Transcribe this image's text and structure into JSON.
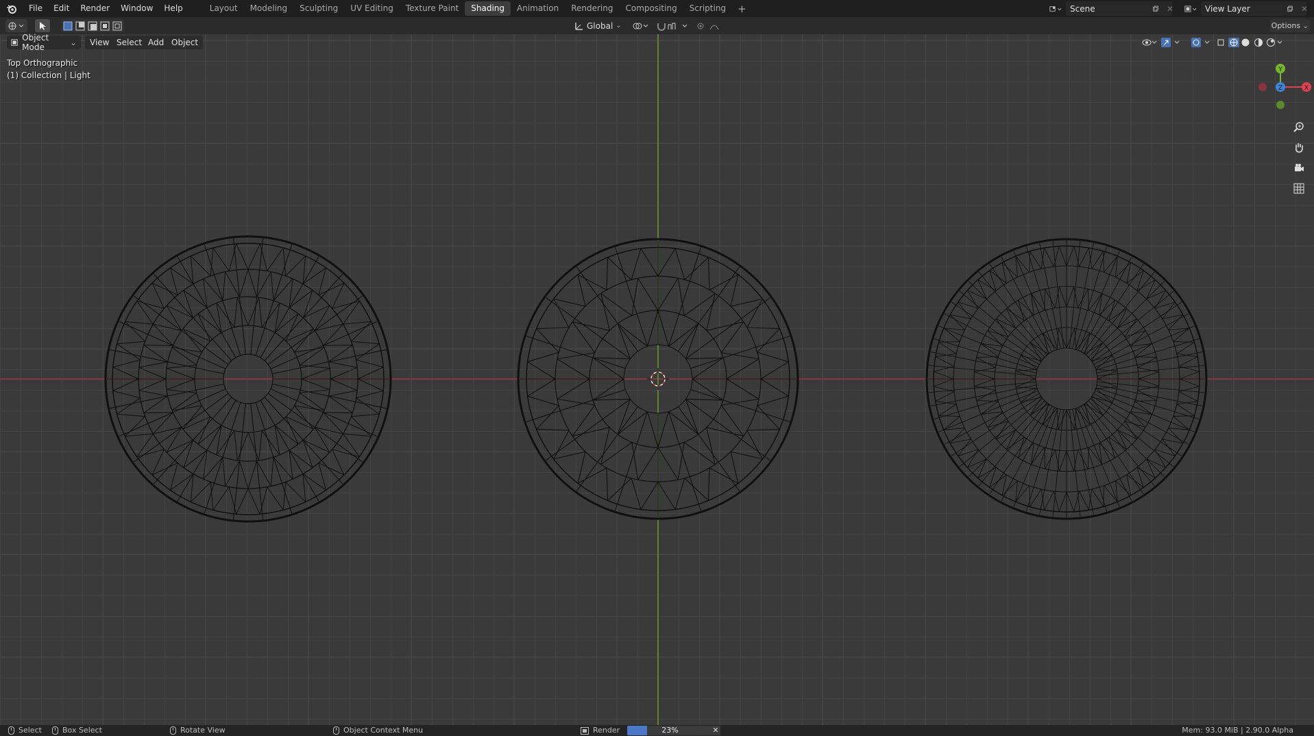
{
  "menu": {
    "items": [
      "File",
      "Edit",
      "Render",
      "Window",
      "Help"
    ]
  },
  "workspaces": {
    "tabs": [
      "Layout",
      "Modeling",
      "Sculpting",
      "UV Editing",
      "Texture Paint",
      "Shading",
      "Animation",
      "Rendering",
      "Compositing",
      "Scripting"
    ],
    "active": "Shading",
    "add_label": "+"
  },
  "scene": {
    "name": "Scene"
  },
  "view_layer": {
    "name": "View Layer"
  },
  "toolbar": {
    "orientation": "Global",
    "options_label": "Options"
  },
  "viewport_header": {
    "mode": "Object Mode",
    "menus": [
      "View",
      "Select",
      "Add",
      "Object"
    ]
  },
  "viewport": {
    "view_name": "Top Orthographic",
    "collection_info": "(1) Collection | Light"
  },
  "gizmo": {
    "y_label": "Y",
    "z_label": "Z",
    "x_label": "X",
    "colors": {
      "x": "#e0404f",
      "y": "#74b92a",
      "z": "#3b87e0"
    }
  },
  "status": {
    "select": "Select",
    "box_select": "Box Select",
    "rotate_view": "Rotate View",
    "context_menu": "Object Context Menu",
    "render_label": "Render",
    "render_progress_text": "23%",
    "render_progress": 0.23,
    "memory": "Mem: 93.0 MiB | 2.90.0 Alpha"
  },
  "colors": {
    "x_axis_line": "#9c3a48",
    "y_axis_line": "#6b9a2a",
    "active_tab_bg": "#3d3d3d",
    "progress_fill": "#4c78c8"
  }
}
